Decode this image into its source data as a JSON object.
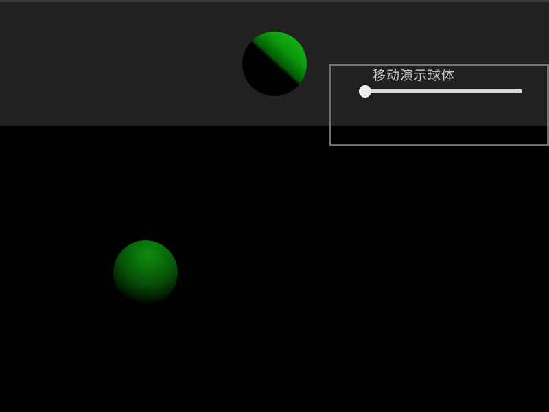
{
  "scene": {
    "spheres": [
      {
        "id": "upper",
        "color": "#16c416"
      },
      {
        "id": "lower",
        "color": "#0f8a0f"
      }
    ],
    "upper_background": "#212121",
    "lower_background": "#000000"
  },
  "control_panel": {
    "title": "移动演示球体",
    "slider": {
      "value": 0,
      "min": 0,
      "max": 1
    }
  }
}
